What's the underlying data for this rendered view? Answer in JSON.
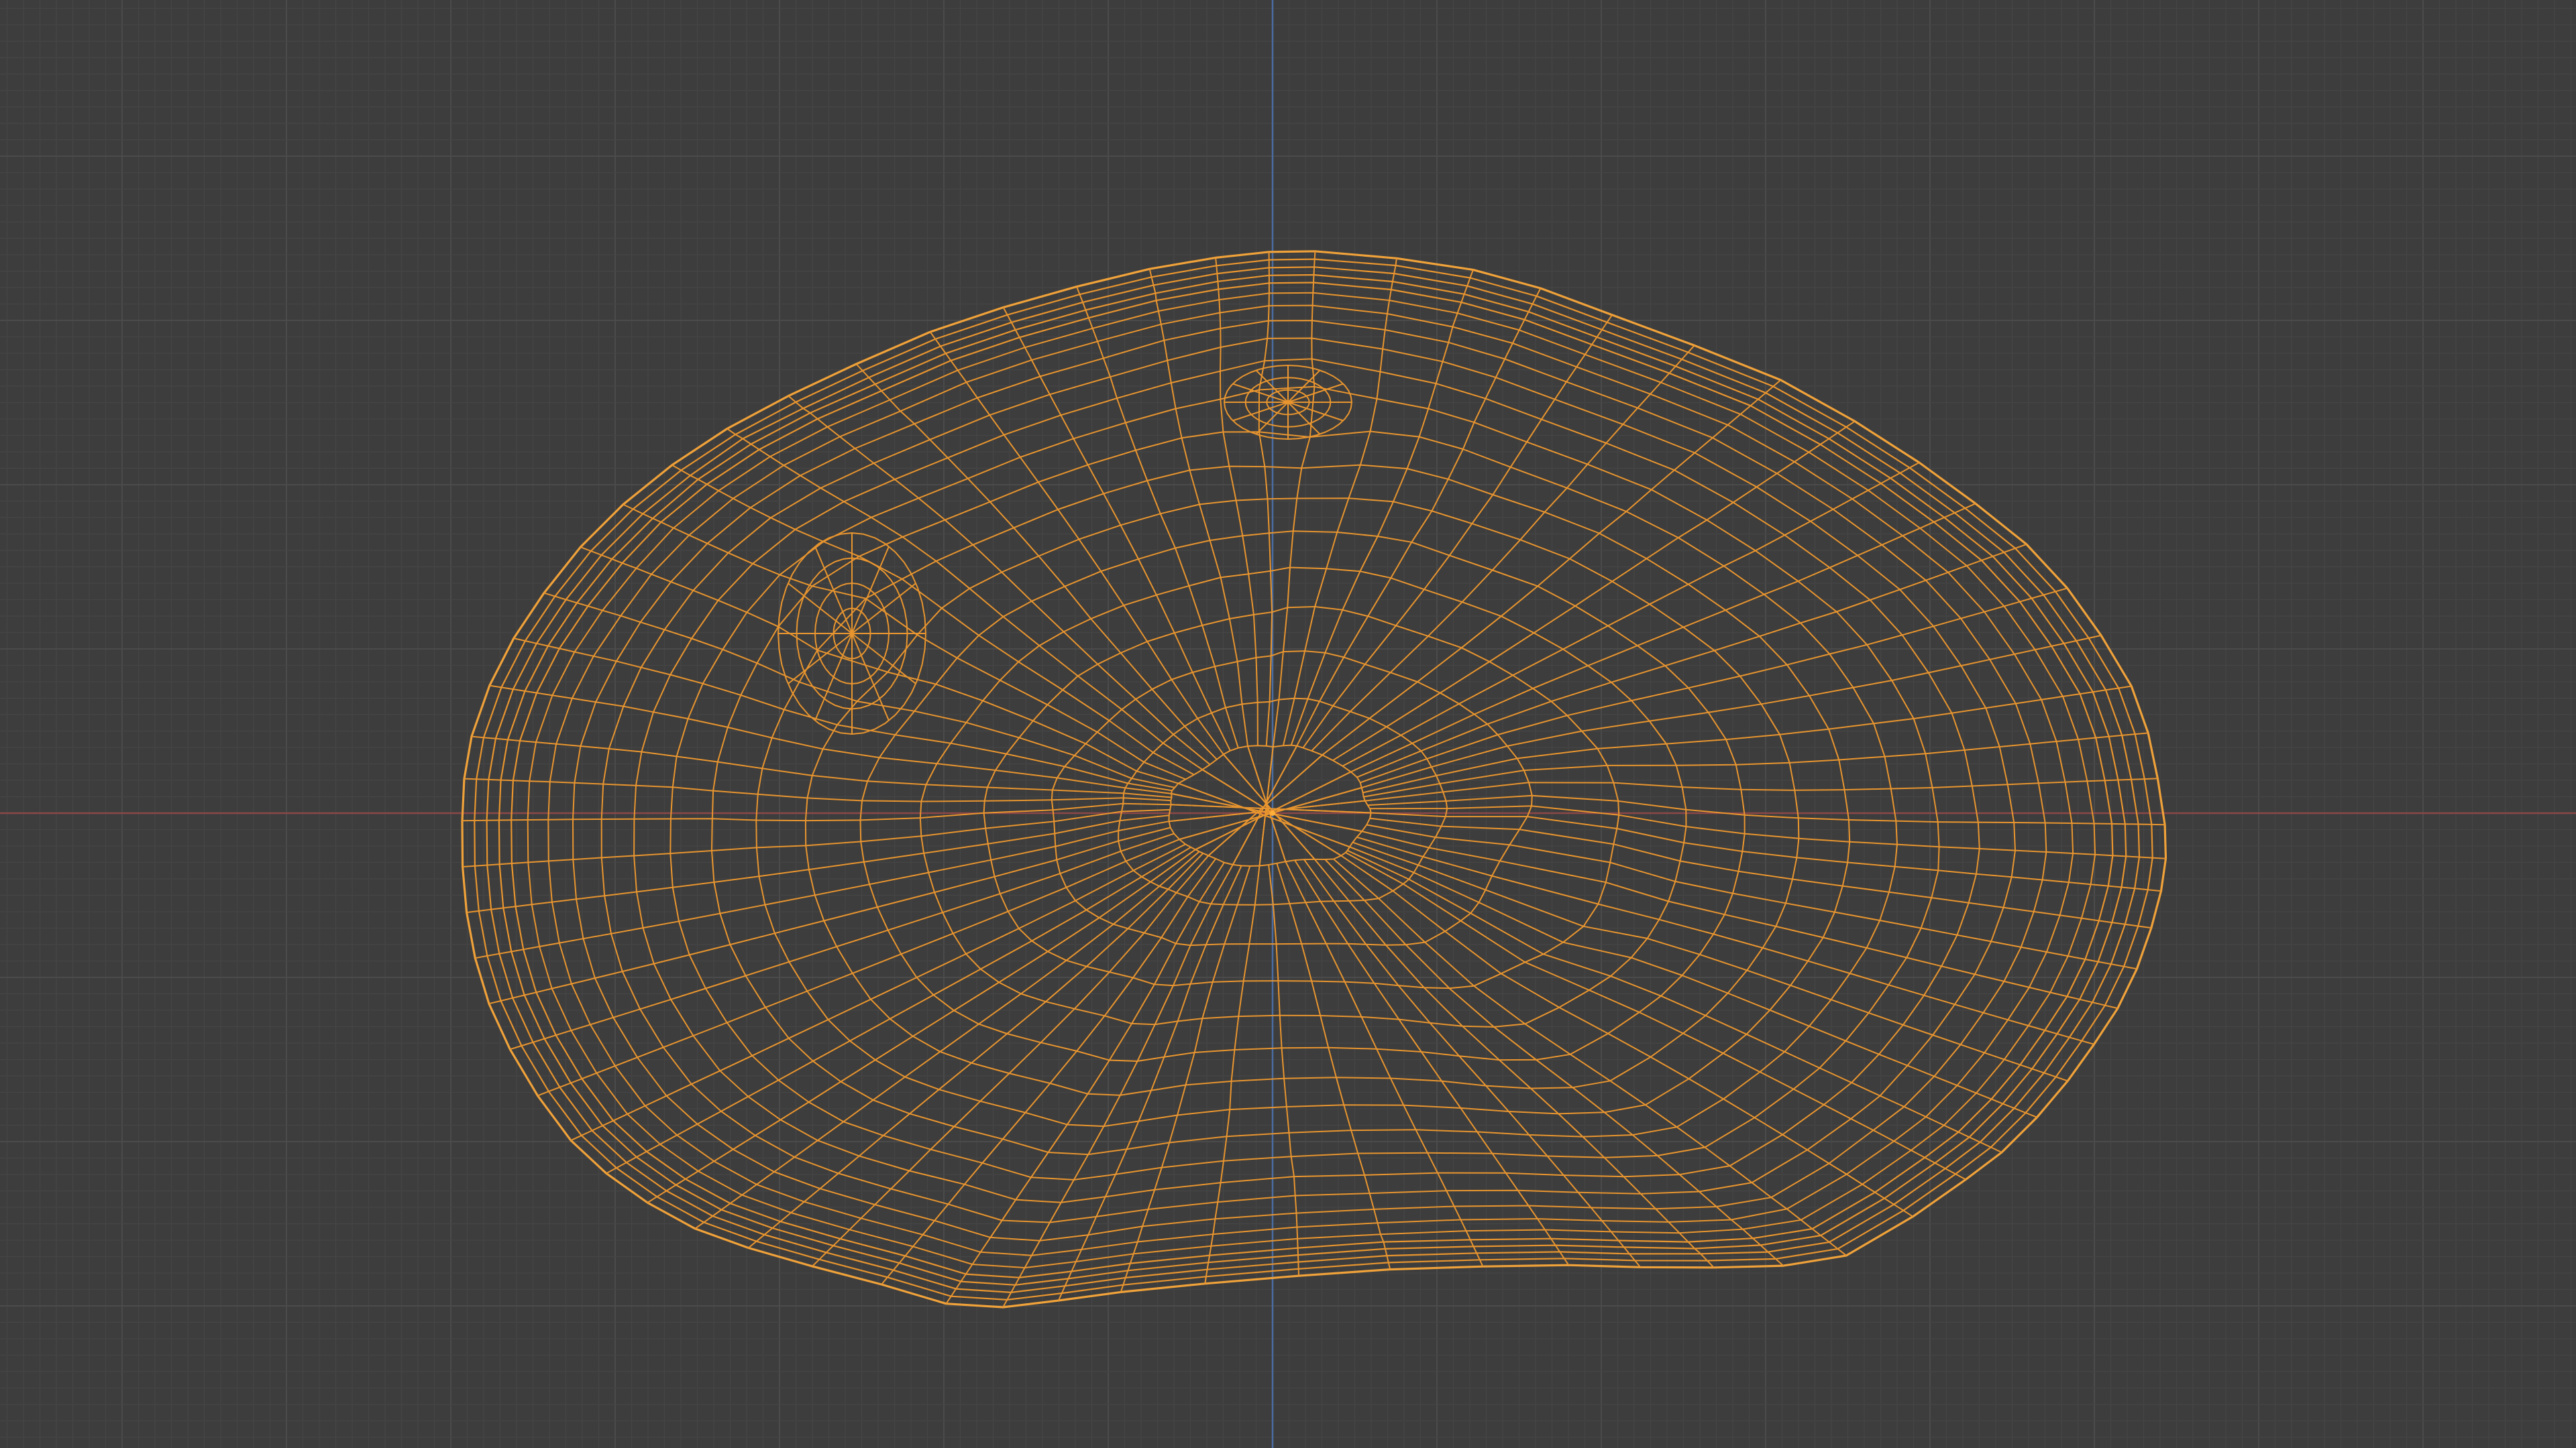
{
  "viewport": {
    "view_mode": "wireframe",
    "colors": {
      "background": "#3d3d3d",
      "grid_minor": "#454545",
      "grid_major": "#4b4b4b",
      "x_axis": "#8c4848",
      "y_axis": "#4a6da0",
      "wire_selected": "#e8952f",
      "wire_outline": "#f0a23a",
      "origin": "#ffae3a"
    },
    "grid": {
      "visible": true,
      "axis_x_visible": true,
      "axis_y_visible": true
    },
    "object": {
      "selected": true,
      "shading": "wireframe",
      "shape": "irregular-rounded-blob"
    }
  }
}
